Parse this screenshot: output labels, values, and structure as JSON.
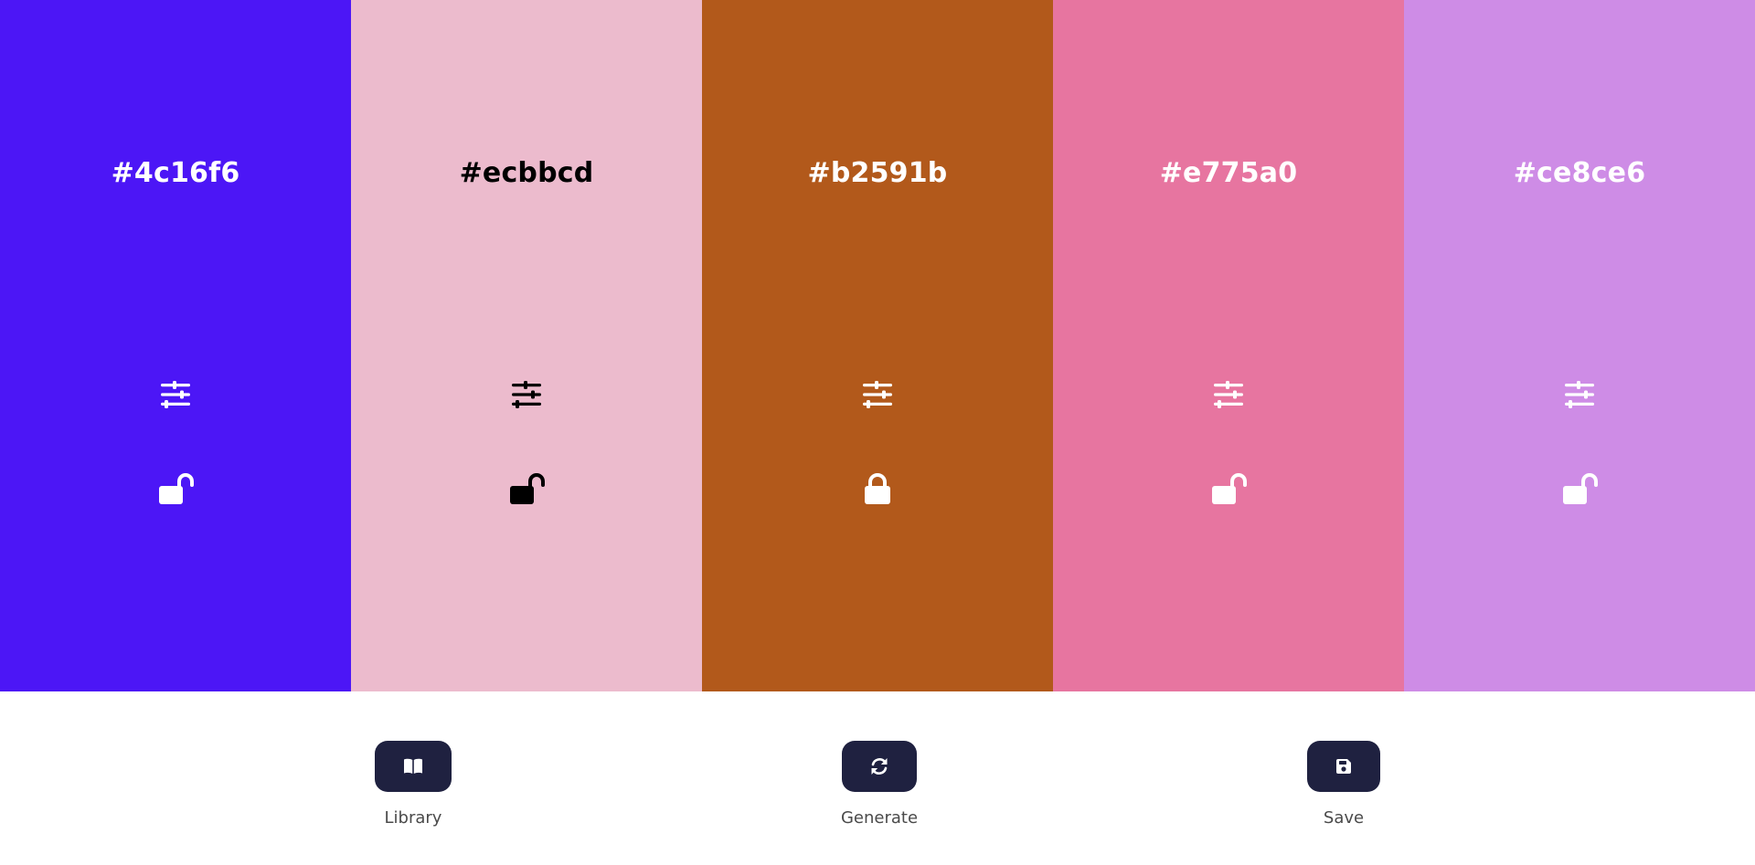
{
  "palette": {
    "colors": [
      {
        "hex": "#4c16f6",
        "text_color": "#ffffff",
        "locked": false
      },
      {
        "hex": "#ecbbcd",
        "text_color": "#000000",
        "locked": false
      },
      {
        "hex": "#b2591b",
        "text_color": "#ffffff",
        "locked": true
      },
      {
        "hex": "#e775a0",
        "text_color": "#ffffff",
        "locked": false
      },
      {
        "hex": "#ce8ce6",
        "text_color": "#ffffff",
        "locked": false
      }
    ]
  },
  "toolbar": {
    "library_label": "Library",
    "generate_label": "Generate",
    "save_label": "Save",
    "button_color": "#1f2140",
    "library_icon": "book-open-icon",
    "generate_icon": "refresh-icon",
    "save_icon": "floppy-disk-icon"
  }
}
